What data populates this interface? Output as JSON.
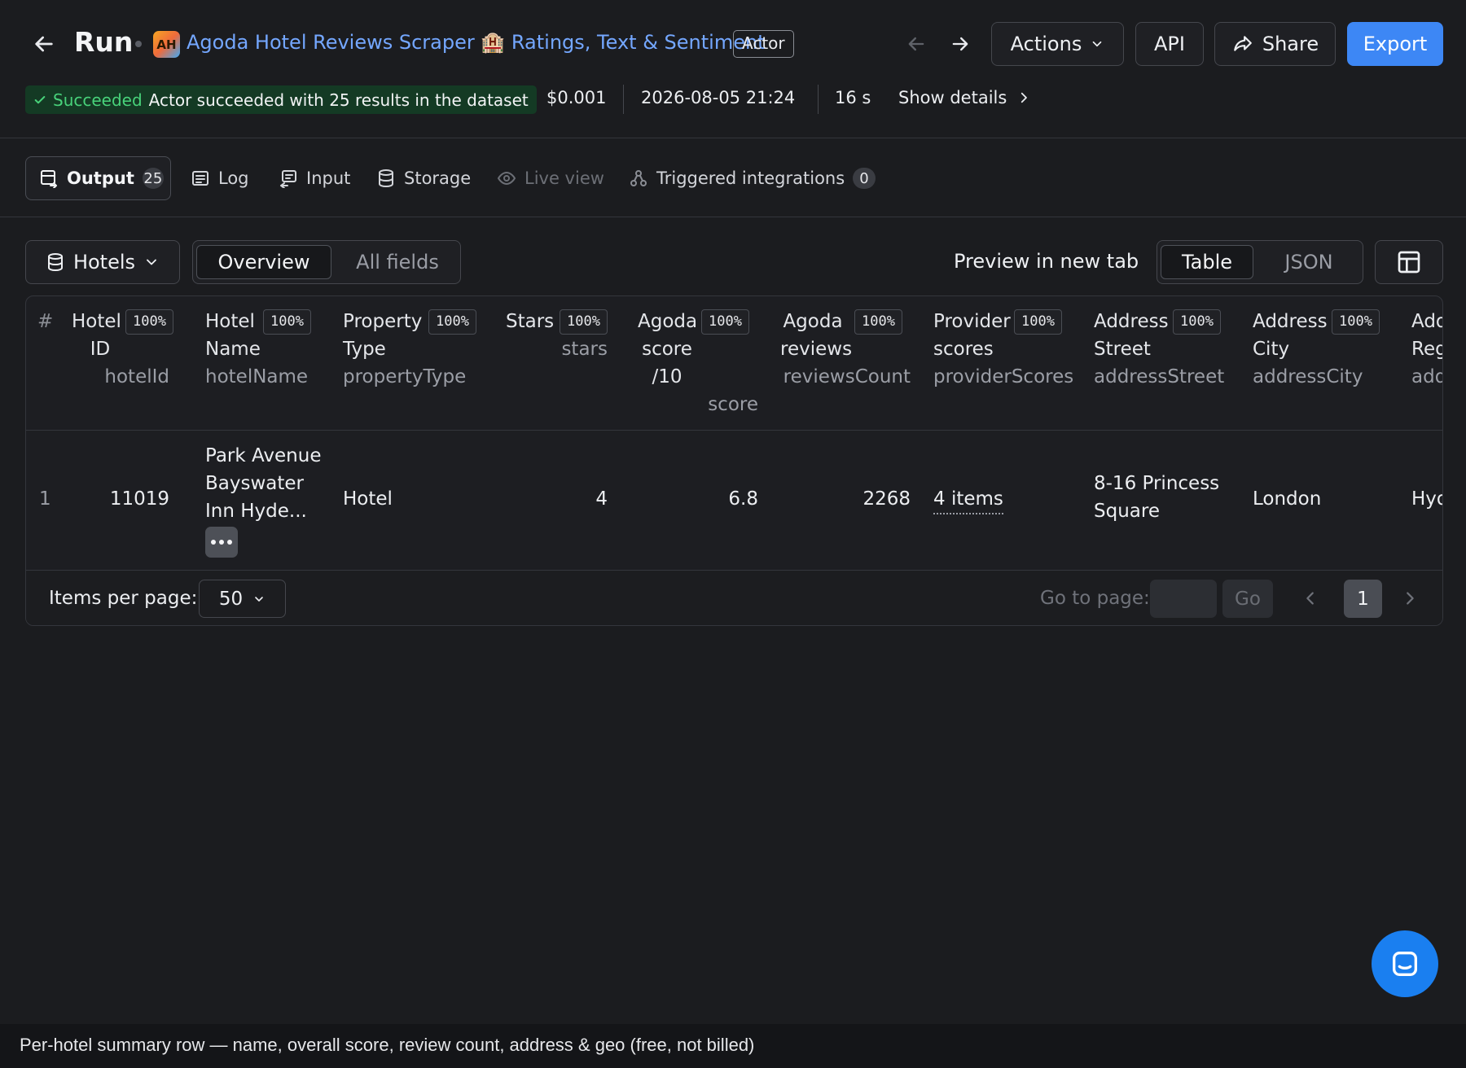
{
  "header": {
    "title": "Run",
    "actor_initials": "AH",
    "actor_name": "Agoda Hotel Reviews Scraper 🏨 Ratings, Text & Sentiment",
    "actor_badge": "Actor",
    "actions_label": "Actions",
    "api_label": "API",
    "share_label": "Share",
    "export_label": "Export"
  },
  "status": {
    "state": "Succeeded",
    "message": "Actor succeeded with 25 results in the dataset",
    "cost": "$0.001",
    "started": "2026-08-05 21:24",
    "duration": "16 s",
    "show_details": "Show details"
  },
  "tabs": [
    {
      "label": "Output",
      "count": "25"
    },
    {
      "label": "Log"
    },
    {
      "label": "Input"
    },
    {
      "label": "Storage"
    },
    {
      "label": "Live view"
    },
    {
      "label": "Triggered integrations",
      "count": "0"
    }
  ],
  "toolbar": {
    "dataset_view": "Hotels",
    "view_overview": "Overview",
    "view_all_fields": "All fields",
    "preview_label": "Preview in new tab",
    "format_table": "Table",
    "format_json": "JSON"
  },
  "table": {
    "index_header": "#",
    "columns": [
      {
        "label1": "Hotel",
        "label2": "ID",
        "key": "hotelId",
        "pct": "100%"
      },
      {
        "label1": "Hotel",
        "label2": "Name",
        "key": "hotelName",
        "pct": "100%"
      },
      {
        "label1": "Property",
        "label2": "Type",
        "key": "propertyType",
        "pct": "100%"
      },
      {
        "label1": "Stars",
        "key": "stars",
        "pct": "100%"
      },
      {
        "label1": "Agoda",
        "label2": "score",
        "label3": "/10",
        "key": "score",
        "pct": "100%"
      },
      {
        "label1": "Agoda",
        "label2": "reviews",
        "key": "reviewsCount",
        "pct": "100%"
      },
      {
        "label1": "Provider",
        "label2": "scores",
        "key": "providerScores",
        "pct": "100%"
      },
      {
        "label1": "Address",
        "label2": "Street",
        "key": "addressStreet",
        "pct": "100%"
      },
      {
        "label1": "Address",
        "label2": "City",
        "key": "addressCity",
        "pct": "100%"
      },
      {
        "label1": "Add",
        "label2": "Reg",
        "key": "add"
      }
    ],
    "rows": [
      {
        "index": "1",
        "hotelId": "11019",
        "hotelName_line1": "Park Avenue",
        "hotelName_line2": "Bayswater",
        "hotelName_line3": "Inn Hyde...",
        "propertyType": "Hotel",
        "stars": "4",
        "score": "6.8",
        "reviewsCount": "2268",
        "providerScores": "4 items",
        "addressStreet_line1": "8-16 Princess",
        "addressStreet_line2": "Square",
        "addressCity": "London",
        "addressRegion": "Hyd"
      }
    ]
  },
  "pagination": {
    "items_per_page_label": "Items per page:",
    "items_per_page": "50",
    "go_to_page_label": "Go to page:",
    "go_label": "Go",
    "current_page": "1"
  },
  "caption": "Per-hotel summary row — name, overall score, review count, address & geo (free, not billed)",
  "colors": {
    "accent": "#3d87f5",
    "link": "#74a7ff",
    "success": "#48d27a",
    "background": "#1b1c1f"
  }
}
